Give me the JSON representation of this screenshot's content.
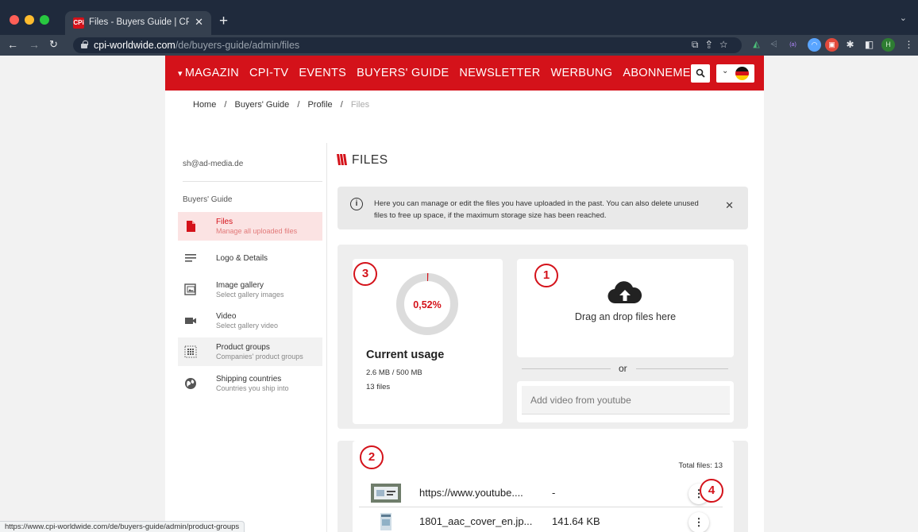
{
  "browser": {
    "tab_title": "Files - Buyers Guide | CPi worldwide",
    "favicon_text": "CPi",
    "url_domain": "cpi-worldwide.com",
    "url_path": "/de/buyers-guide/admin/files",
    "profile_initial": "H",
    "status_url": "https://www.cpi-worldwide.com/de/buyers-guide/admin/product-groups"
  },
  "nav": {
    "items": [
      "MAGAZIN",
      "CPI-TV",
      "EVENTS",
      "BUYERS' GUIDE",
      "NEWSLETTER",
      "WERBUNG",
      "ABONNEMENT"
    ]
  },
  "breadcrumb": {
    "items": [
      "Home",
      "Buyers' Guide",
      "Profile",
      "Files"
    ],
    "separator": "/"
  },
  "sidebar": {
    "email": "sh@ad-media.de",
    "section": "Buyers' Guide",
    "items": [
      {
        "title": "Files",
        "sub": "Manage all uploaded files"
      },
      {
        "title": "Logo & Details",
        "sub": ""
      },
      {
        "title": "Image gallery",
        "sub": "Select gallery images"
      },
      {
        "title": "Video",
        "sub": "Select gallery video"
      },
      {
        "title": "Product groups",
        "sub": "Companies' product groups"
      },
      {
        "title": "Shipping countries",
        "sub": "Countries you ship into"
      }
    ]
  },
  "main": {
    "title": "FILES",
    "info": "Here you can manage or edit the files you have uploaded in the past. You can also delete unused files to free up space, if the maximum storage size has been reached.",
    "usage": {
      "percent_label": "0,52%",
      "percent": 0.52,
      "title": "Current usage",
      "size": "2.6 MB / 500 MB",
      "count": "13 files"
    },
    "upload": {
      "text": "Drag an drop files here",
      "or": "or",
      "youtube_placeholder": "Add video from youtube"
    },
    "list": {
      "total": "Total files: 13",
      "rows": [
        {
          "name": "https://www.youtube....",
          "size": "-"
        },
        {
          "name": "1801_aac_cover_en.jp...",
          "size": "141.64 KB"
        }
      ]
    },
    "markers": [
      "1",
      "2",
      "3",
      "4"
    ]
  },
  "colors": {
    "brand_red": "#d4121a",
    "chrome_dark": "#1f2a3c",
    "active_bg": "#fbe3e3"
  },
  "icons": {
    "upload": "cloud-upload-icon",
    "info": "info-icon",
    "search": "search-icon"
  }
}
